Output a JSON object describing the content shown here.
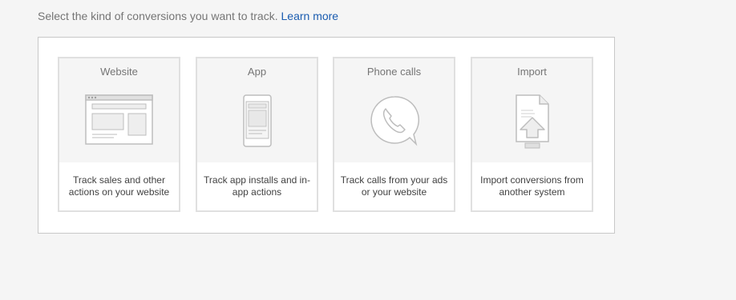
{
  "intro": {
    "text": "Select the kind of conversions you want to track.",
    "link_label": "Learn more"
  },
  "cards": [
    {
      "title": "Website",
      "description": "Track sales and other actions on your website",
      "icon": "website-icon"
    },
    {
      "title": "App",
      "description": "Track app installs and in-app actions",
      "icon": "phone-app-icon"
    },
    {
      "title": "Phone calls",
      "description": "Track calls from your ads or your website",
      "icon": "phone-call-icon"
    },
    {
      "title": "Import",
      "description": "Import conversions from another system",
      "icon": "import-file-icon"
    }
  ],
  "colors": {
    "page_bg": "#f5f5f5",
    "link": "#1a5cb0",
    "card_border": "#e0e0e0",
    "illustration_stroke": "#bdbdbd"
  }
}
